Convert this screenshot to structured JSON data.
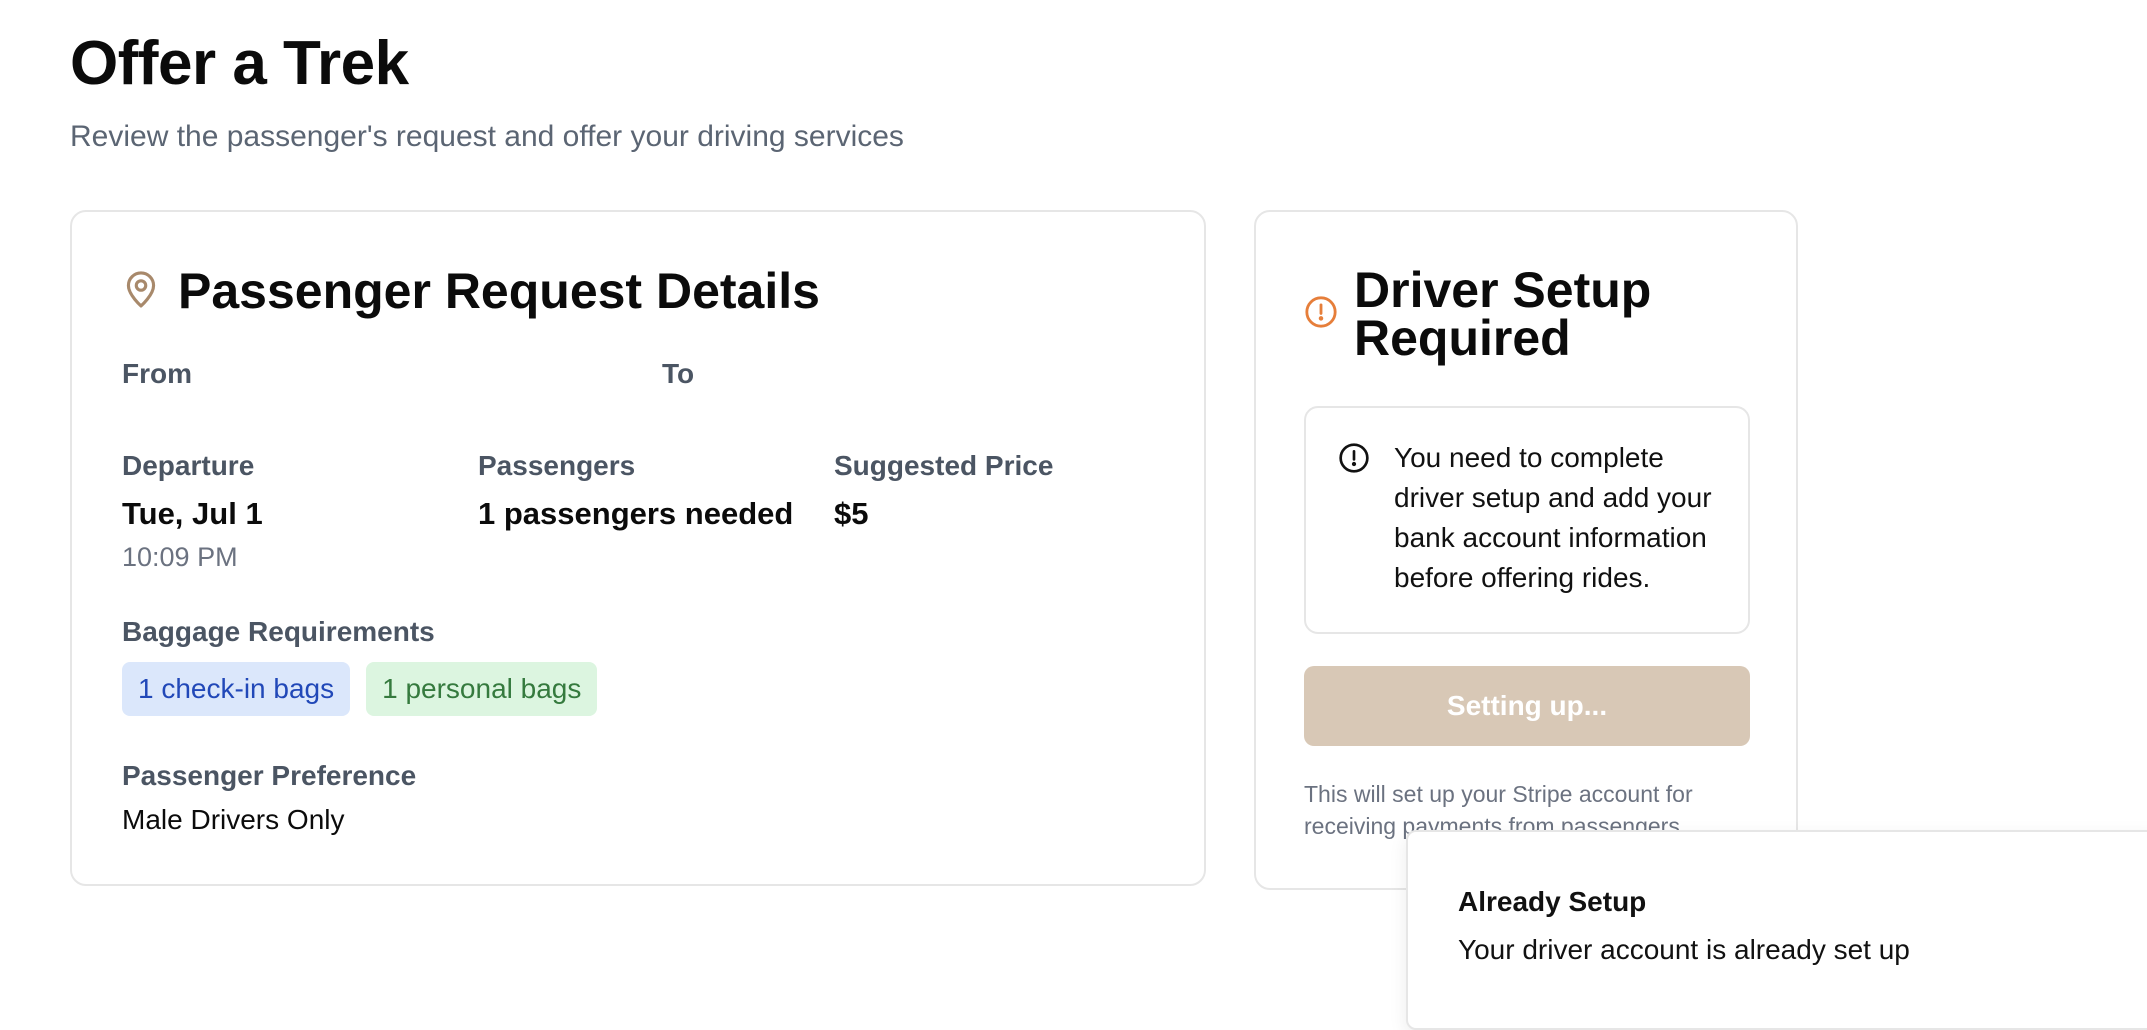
{
  "page": {
    "title": "Offer a Trek",
    "subtitle": "Review the passenger's request and offer your driving services"
  },
  "request": {
    "title": "Passenger Request Details",
    "icon": "map-pin-icon",
    "from_label": "From",
    "to_label": "To",
    "departure_label": "Departure",
    "departure_date": "Tue, Jul 1",
    "departure_time": "10:09 PM",
    "passengers_label": "Passengers",
    "passengers_value": "1 passengers needed",
    "price_label": "Suggested Price",
    "price_value": "$5",
    "baggage_label": "Baggage Requirements",
    "baggage": [
      "1 check-in bags",
      "1 personal bags"
    ],
    "preference_label": "Passenger Preference",
    "preference_value": "Male Drivers Only"
  },
  "driver": {
    "title": "Driver Setup Required",
    "icon": "alert-circle-icon",
    "alert_text": "You need to complete driver setup and add your bank account information before offering rides.",
    "button_label": "Setting up...",
    "note": "This will set up your Stripe account for receiving payments from passengers."
  },
  "toast": {
    "title": "Already Setup",
    "description": "Your driver account is already set up"
  },
  "colors": {
    "accent": "#a8896b",
    "warning": "#e67e3a",
    "button_disabled": "#d8c8b6",
    "badge_blue_bg": "#dbe7fb",
    "badge_green_bg": "#dcf5e0"
  }
}
